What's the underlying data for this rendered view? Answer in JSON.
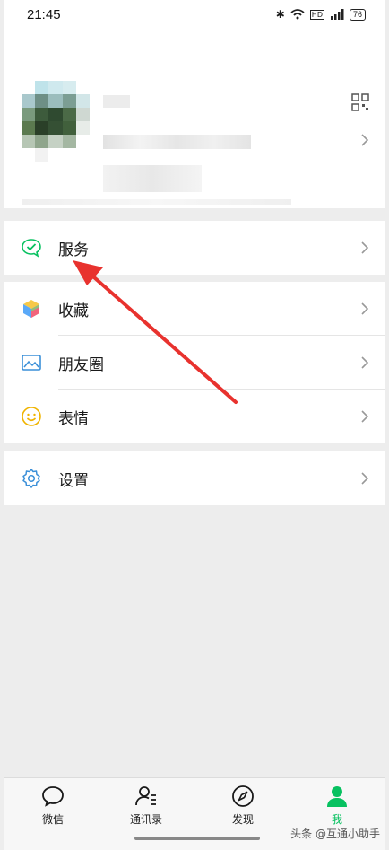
{
  "status_bar": {
    "time": "21:45",
    "battery": "76"
  },
  "menu": {
    "services": "服务",
    "favorites": "收藏",
    "moments": "朋友圈",
    "stickers": "表情",
    "settings": "设置"
  },
  "tabbar": {
    "tabs": [
      {
        "label": "微信"
      },
      {
        "label": "通讯录"
      },
      {
        "label": "发现"
      },
      {
        "label": "我"
      }
    ]
  },
  "watermark": "头条 @互通小助手",
  "colors": {
    "accent": "#07c160",
    "arrow": "#e8322e"
  }
}
